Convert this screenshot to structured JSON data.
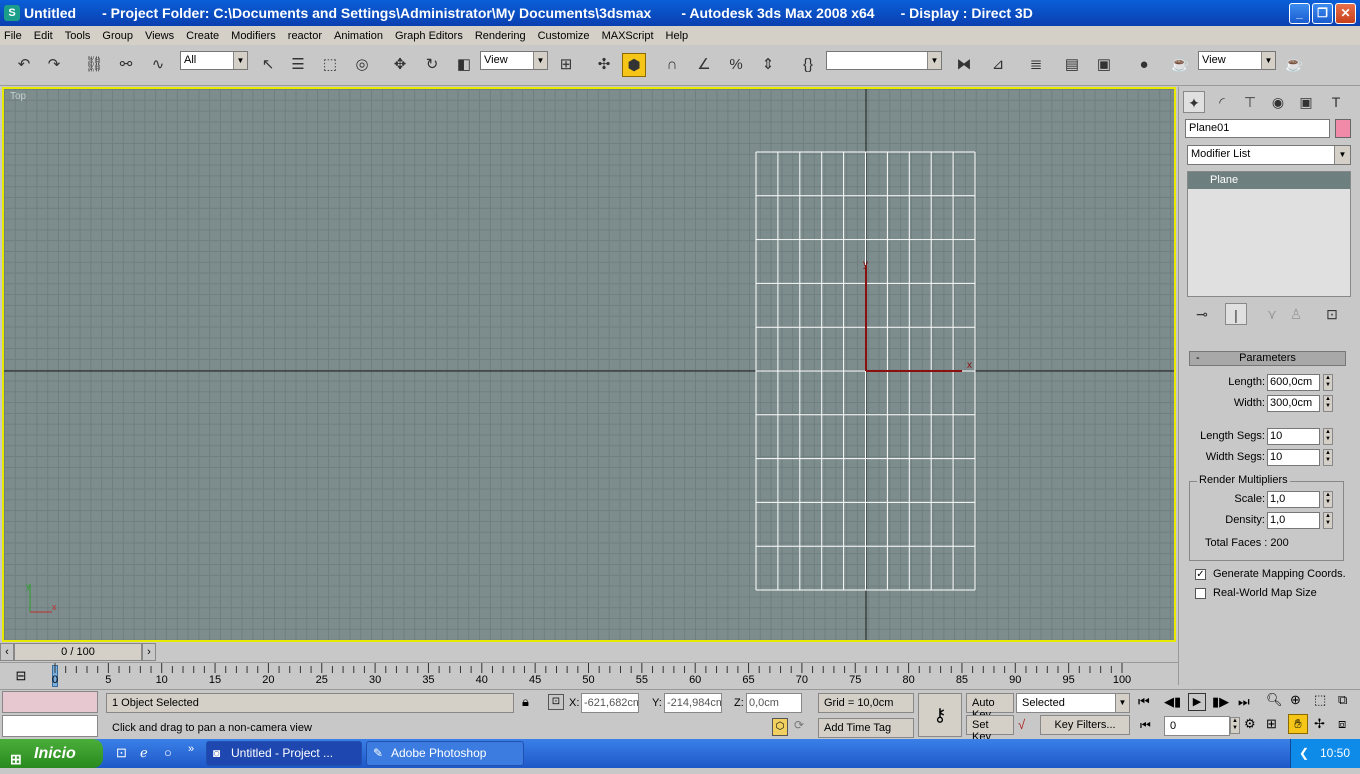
{
  "window": {
    "title": "Untitled",
    "project": "- Project Folder: C:\\Documents and Settings\\Administrator\\My Documents\\3dsmax",
    "app": "- Autodesk 3ds Max 2008 x64",
    "display": "- Display : Direct 3D"
  },
  "menu": [
    "File",
    "Edit",
    "Tools",
    "Group",
    "Views",
    "Create",
    "Modifiers",
    "reactor",
    "Animation",
    "Graph Editors",
    "Rendering",
    "Customize",
    "MAXScript",
    "Help"
  ],
  "toolbar": {
    "selection_filter": "All",
    "ref_coord": "View",
    "named_selection": "",
    "view_dropdown": "View"
  },
  "viewport": {
    "label": "Top",
    "axis_x": "x",
    "axis_y": "y"
  },
  "panel": {
    "object_name": "Plane01",
    "object_color": "#f08aa8",
    "modifier_list": "Modifier List",
    "stack_item": "Plane",
    "rollout": "Parameters",
    "rollout_collapse": "-",
    "length_label": "Length:",
    "length": "600,0cm",
    "width_label": "Width:",
    "width": "300,0cm",
    "length_segs_label": "Length Segs:",
    "length_segs": "10",
    "width_segs_label": "Width Segs:",
    "width_segs": "10",
    "render_mult": "Render Multipliers",
    "scale_label": "Scale:",
    "scale": "1,0",
    "density_label": "Density:",
    "density": "1,0",
    "total_faces": "Total Faces : 200",
    "gen_mapping": "Generate Mapping Coords.",
    "real_world": "Real-World Map Size"
  },
  "timeline": {
    "frame": "0 / 100",
    "ticks": [
      "0",
      "5",
      "10",
      "15",
      "20",
      "25",
      "30",
      "35",
      "40",
      "45",
      "50",
      "55",
      "60",
      "65",
      "70",
      "75",
      "80",
      "85",
      "90",
      "95",
      "100"
    ]
  },
  "status": {
    "selected": "1 Object Selected",
    "prompt": "Click and drag to pan a non-camera view",
    "x_label": "X:",
    "x": "-621,682cm",
    "y_label": "Y:",
    "y": "-214,984cm",
    "z_label": "Z:",
    "z": "0,0cm",
    "grid": "Grid = 10,0cm",
    "add_time_tag": "Add Time Tag",
    "auto_key": "Auto Key",
    "set_key": "Set Key",
    "key_mode": "Selected",
    "key_filters": "Key Filters...",
    "current_frame": "0"
  },
  "taskbar": {
    "start": "Inicio",
    "tasks": [
      "Untitled    - Project ...",
      "Adobe Photoshop"
    ],
    "clock": "10:50"
  }
}
